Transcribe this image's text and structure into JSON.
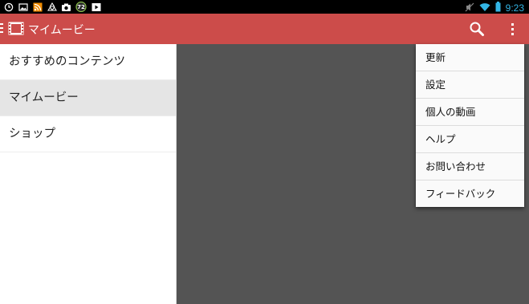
{
  "status_bar": {
    "left_icons": [
      "clock-icon",
      "image-icon",
      "rss-icon",
      "recycle-icon",
      "camera-icon",
      "badge-72-icon",
      "play-icon"
    ],
    "badge_number": "72",
    "time": "9:23"
  },
  "action_bar": {
    "title": "マイムービー",
    "background": "#cc4c4a"
  },
  "drawer": {
    "items": [
      {
        "label": "おすすめのコンテンツ",
        "selected": false
      },
      {
        "label": "マイムービー",
        "selected": true
      },
      {
        "label": "ショップ",
        "selected": false
      }
    ]
  },
  "menu": {
    "items": [
      {
        "label": "更新"
      },
      {
        "label": "設定"
      },
      {
        "label": "個人の動画"
      },
      {
        "label": "ヘルプ"
      },
      {
        "label": "お問い合わせ"
      },
      {
        "label": "フィードバック"
      }
    ]
  },
  "colors": {
    "accent": "#cc4c4a",
    "content_bg": "#545454",
    "clock": "#33b5e5"
  }
}
